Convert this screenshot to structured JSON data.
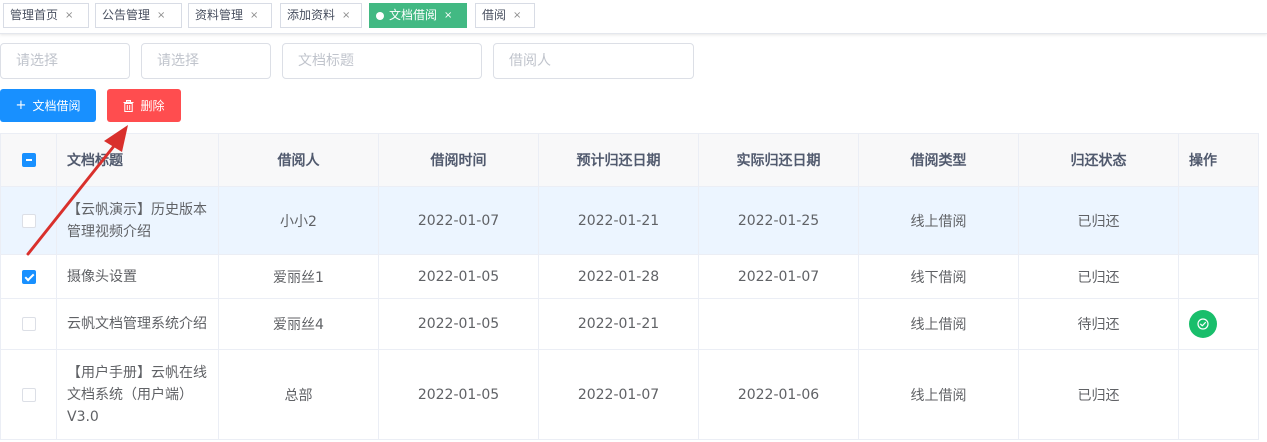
{
  "tabs": [
    {
      "label": "管理首页",
      "active": false
    },
    {
      "label": "公告管理",
      "active": false
    },
    {
      "label": "资料管理",
      "active": false
    },
    {
      "label": "添加资料",
      "active": false
    },
    {
      "label": "文档借阅",
      "active": true
    },
    {
      "label": "借阅",
      "active": false
    }
  ],
  "tab_close_glyph": "×",
  "filters": {
    "select1_placeholder": "请选择",
    "select2_placeholder": "请选择",
    "title_placeholder": "文档标题",
    "borrower_placeholder": "借阅人"
  },
  "toolbar": {
    "add_label": "文档借阅",
    "add_icon": "+",
    "delete_label": "删除",
    "delete_icon": "trash-icon"
  },
  "table": {
    "columns": [
      "文档标题",
      "借阅人",
      "借阅时间",
      "预计归还日期",
      "实际归还日期",
      "借阅类型",
      "归还状态",
      "操作"
    ],
    "header_checkbox": "indeterminate",
    "rows": [
      {
        "checked": false,
        "highlight": true,
        "title": "【云帆演示】历史版本管理视频介绍",
        "borrower": "小小2",
        "borrow_date": "2022-01-07",
        "expected_return": "2022-01-21",
        "actual_return": "2022-01-25",
        "type": "线上借阅",
        "status": "已归还",
        "action": ""
      },
      {
        "checked": true,
        "highlight": false,
        "title": "摄像头设置",
        "borrower": "爱丽丝1",
        "borrow_date": "2022-01-05",
        "expected_return": "2022-01-28",
        "actual_return": "2022-01-07",
        "type": "线下借阅",
        "status": "已归还",
        "action": ""
      },
      {
        "checked": false,
        "highlight": false,
        "title": "云帆文档管理系统介绍",
        "borrower": "爱丽丝4",
        "borrow_date": "2022-01-05",
        "expected_return": "2022-01-21",
        "actual_return": "",
        "type": "线上借阅",
        "status": "待归还",
        "action": "confirm-return"
      },
      {
        "checked": false,
        "highlight": false,
        "title": "【用户手册】云帆在线文档系统（用户端）V3.0",
        "borrower": "总部",
        "borrow_date": "2022-01-05",
        "expected_return": "2022-01-07",
        "actual_return": "2022-01-06",
        "type": "线上借阅",
        "status": "已归还",
        "action": ""
      }
    ]
  },
  "colors": {
    "active_tab": "#42b983",
    "primary": "#1890ff",
    "danger": "#ff4d4f",
    "success": "#19be6b",
    "row_highlight": "#ecf5ff",
    "annotation_arrow": "#d9302c"
  }
}
